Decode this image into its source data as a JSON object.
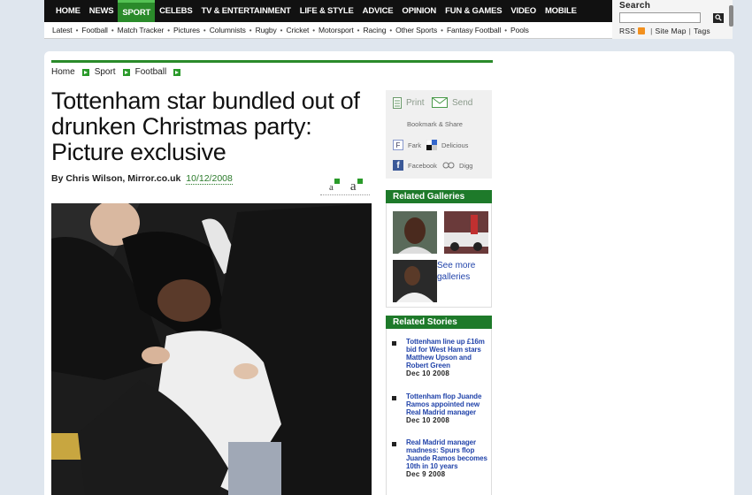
{
  "nav": {
    "main": [
      "HOME",
      "NEWS",
      "SPORT",
      "CELEBS",
      "TV & ENTERTAINMENT",
      "LIFE & STYLE",
      "ADVICE",
      "OPINION",
      "FUN & GAMES",
      "VIDEO",
      "MOBILE"
    ],
    "active": "SPORT",
    "sub": [
      "Latest",
      "Football",
      "Match Tracker",
      "Pictures",
      "Columnists",
      "Rugby",
      "Cricket",
      "Motorsport",
      "Racing",
      "Other Sports",
      "Fantasy Football",
      "Pools"
    ]
  },
  "search": {
    "title": "Search",
    "rss": "RSS",
    "sitemap": "Site Map",
    "tags": "Tags"
  },
  "breadcrumb": [
    "Home",
    "Sport",
    "Football"
  ],
  "article": {
    "headline": "Tottenham star bundled out of drunken Christmas party: Picture exclusive",
    "byline": "By Chris Wilson, Mirror.co.uk",
    "date": "10/12/2008",
    "text_small": "a",
    "text_large": "a"
  },
  "tools": {
    "print": "Print",
    "send": "Send",
    "bookmark": "Bookmark & Share",
    "fark": "Fark",
    "delicious": "Delicious",
    "facebook": "Facebook",
    "digg": "Digg"
  },
  "galleries": {
    "title": "Related Galleries",
    "more": "See more galleries"
  },
  "stories": {
    "title": "Related Stories",
    "items": [
      {
        "title": "Tottenham line up £16m bid for West Ham stars Matthew Upson and Robert Green",
        "date": "Dec 10 2008"
      },
      {
        "title": "Tottenham flop Juande Ramos appointed new Real Madrid manager",
        "date": "Dec 10 2008"
      },
      {
        "title": "Real Madrid manager madness: Spurs flop Juande Ramos becomes 10th in 10 years",
        "date": "Dec 9 2008"
      }
    ]
  },
  "colors": {
    "nav_bg": "#111111",
    "accent_green": "#2a8a2a",
    "box_header": "#1e7a2a",
    "link_blue": "#2244aa",
    "page_bg": "#dfe6ee"
  }
}
